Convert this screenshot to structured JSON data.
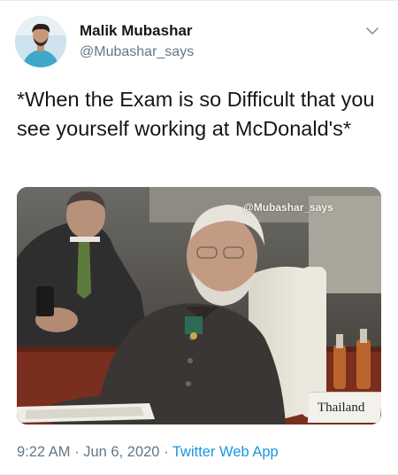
{
  "tweet": {
    "display_name": "Malik Mubashar",
    "handle": "@Mubashar_says",
    "text": "*When the Exam is so Difficult that you see yourself working at McDonald's*",
    "media": {
      "watermark": "@Mubashar_says",
      "nameplate": "Thailand"
    },
    "time": "9:22 AM",
    "separator": "·",
    "date": "Jun 6, 2020",
    "source": "Twitter Web App"
  },
  "icons": {
    "menu": "chevron-down-icon",
    "avatar": "avatar-image"
  },
  "colors": {
    "name": "#14171a",
    "secondary": "#657786",
    "link": "#1b95e0"
  }
}
